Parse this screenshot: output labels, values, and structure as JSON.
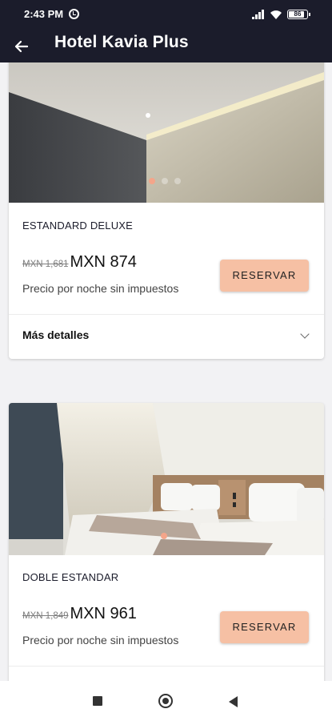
{
  "status_bar": {
    "time": "2:43 PM",
    "battery": "86",
    "icons": [
      "alarm-icon",
      "signal-icon",
      "wifi-icon",
      "battery-icon"
    ]
  },
  "app_bar": {
    "title": "Hotel Kavia Plus",
    "back_icon": "arrow-left-icon"
  },
  "rooms": [
    {
      "name": "ESTANDARD DELUXE",
      "old_price": "MXN 1,681",
      "price": "MXN 874",
      "price_note": "Precio por noche sin impuestos",
      "reserve_label": "RESERVAR",
      "details_label": "Más detalles",
      "photo_dots": 3,
      "active_dot": 0
    },
    {
      "name": "DOBLE ESTANDAR",
      "old_price": "MXN 1,849",
      "price": "MXN 961",
      "price_note": "Precio por noche sin impuestos",
      "reserve_label": "RESERVAR",
      "photo_dots": 1,
      "active_dot": 0
    }
  ],
  "colors": {
    "app_bar": "#1b1c2b",
    "reserve_button": "#f6c0a4",
    "active_dot": "#f4a58a",
    "background": "#f2f2f4"
  },
  "nav_bar": {
    "icons": [
      "recents-square-icon",
      "home-circle-icon",
      "back-triangle-icon"
    ]
  }
}
